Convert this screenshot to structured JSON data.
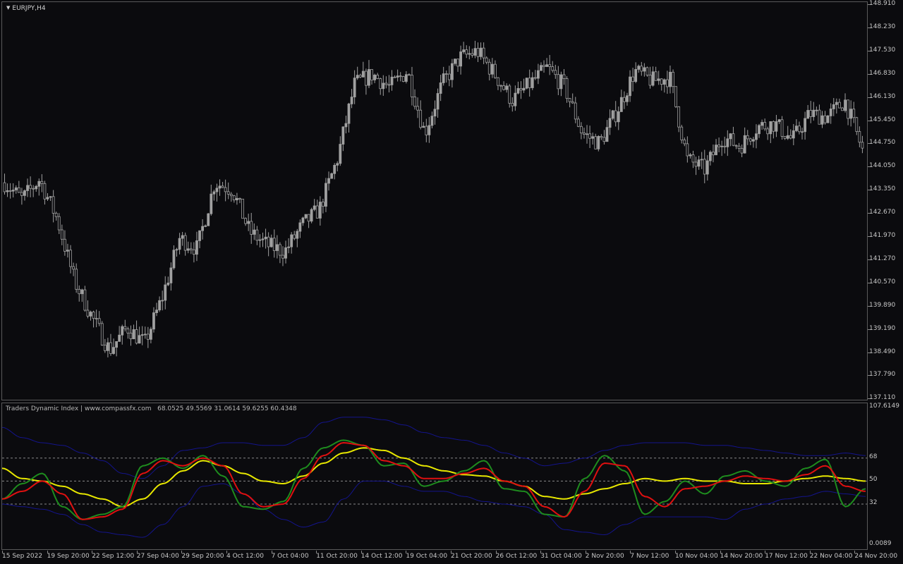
{
  "chart_title": "EURJPY,H4",
  "price_axis": [
    "148.910",
    "148.230",
    "147.530",
    "146.830",
    "146.130",
    "145.450",
    "144.750",
    "144.050",
    "143.350",
    "142.670",
    "141.970",
    "141.270",
    "140.570",
    "139.890",
    "139.190",
    "138.490",
    "137.790",
    "137.110"
  ],
  "indicator": {
    "name": "Traders Dynamic Index | www.compassfx.com",
    "values": "68.0525 49.5569 31.0614 59.6255 60.4348",
    "axis_top": "107.6149",
    "levels": [
      "68",
      "50",
      "32"
    ],
    "axis_bottom": "0.0089"
  },
  "time_axis": [
    "15 Sep 2022",
    "19 Sep 20:00",
    "22 Sep 12:00",
    "27 Sep 04:00",
    "29 Sep 20:00",
    "4 Oct 12:00",
    "7 Oct 04:00",
    "11 Oct 20:00",
    "14 Oct 12:00",
    "19 Oct 04:00",
    "21 Oct 20:00",
    "26 Oct 12:00",
    "31 Oct 04:00",
    "2 Nov 20:00",
    "7 Nov 12:00",
    "10 Nov 04:00",
    "14 Nov 20:00",
    "17 Nov 12:00",
    "22 Nov 04:00",
    "24 Nov 20:00"
  ],
  "colors": {
    "background": "#0b0b0e",
    "candle": "#a0a0a0",
    "rsi_line": "#1e8c1e",
    "signal_line": "#e01010",
    "market_base": "#e8e800",
    "bands": "#14148c",
    "level_lines": "#8a8a8a"
  },
  "chart_data": [
    {
      "type": "candlestick",
      "title": "EURJPY,H4",
      "ylim": [
        137.11,
        148.91
      ],
      "close_trace": [
        [
          "15 Sep 2022",
          143.5
        ],
        [
          "16 Sep",
          143.0
        ],
        [
          "19 Sep 20:00",
          143.6
        ],
        [
          "20 Sep",
          142.4
        ],
        [
          "21 Sep",
          140.5
        ],
        [
          "22 Sep 12:00",
          139.4
        ],
        [
          "23 Sep",
          138.4
        ],
        [
          "26 Sep",
          139.1
        ],
        [
          "27 Sep 04:00",
          138.6
        ],
        [
          "28 Sep",
          140.0
        ],
        [
          "29 Sep 20:00",
          141.8
        ],
        [
          "3 Oct",
          141.5
        ],
        [
          "4 Oct 12:00",
          143.5
        ],
        [
          "5 Oct",
          143.3
        ],
        [
          "6 Oct",
          142.0
        ],
        [
          "7 Oct 04:00",
          141.6
        ],
        [
          "10 Oct",
          141.4
        ],
        [
          "11 Oct 20:00",
          142.2
        ],
        [
          "12 Oct",
          142.7
        ],
        [
          "13 Oct",
          144.2
        ],
        [
          "14 Oct 12:00",
          146.5
        ],
        [
          "17 Oct",
          146.8
        ],
        [
          "18 Oct",
          146.4
        ],
        [
          "19 Oct 04:00",
          146.9
        ],
        [
          "20 Oct",
          145.0
        ],
        [
          "21 Oct 20:00",
          146.5
        ],
        [
          "24 Oct",
          147.3
        ],
        [
          "25 Oct",
          147.5
        ],
        [
          "26 Oct 12:00",
          146.8
        ],
        [
          "27 Oct",
          146.0
        ],
        [
          "28 Oct",
          146.5
        ],
        [
          "31 Oct 04:00",
          147.0
        ],
        [
          "1 Nov",
          146.4
        ],
        [
          "2 Nov 20:00",
          145.0
        ],
        [
          "3 Nov",
          144.7
        ],
        [
          "4 Nov",
          145.7
        ],
        [
          "7 Nov 12:00",
          146.9
        ],
        [
          "8 Nov",
          146.6
        ],
        [
          "9 Nov",
          146.7
        ],
        [
          "10 Nov 04:00",
          144.2
        ],
        [
          "11 Nov",
          143.9
        ],
        [
          "14 Nov 20:00",
          144.9
        ],
        [
          "15 Nov",
          144.6
        ],
        [
          "16 Nov",
          145.2
        ],
        [
          "17 Nov 12:00",
          145.3
        ],
        [
          "18 Nov",
          144.8
        ],
        [
          "21 Nov",
          145.6
        ],
        [
          "22 Nov 04:00",
          145.5
        ],
        [
          "23 Nov",
          146.0
        ],
        [
          "24 Nov 20:00",
          144.5
        ]
      ]
    },
    {
      "type": "line",
      "title": "Traders Dynamic Index",
      "ylim": [
        0.0089,
        107.6149
      ],
      "levels": [
        68,
        50,
        32
      ],
      "series": [
        {
          "name": "rsi",
          "color": "#1e8c1e",
          "values": [
            36,
            48,
            56,
            30,
            20,
            24,
            30,
            62,
            68,
            60,
            70,
            54,
            30,
            28,
            34,
            60,
            76,
            82,
            78,
            62,
            64,
            46,
            50,
            58,
            66,
            44,
            42,
            24,
            22,
            52,
            70,
            58,
            24,
            34,
            50,
            40,
            54,
            58,
            50,
            46,
            60,
            67,
            30,
            44
          ]
        },
        {
          "name": "signal",
          "color": "#e01010",
          "values": [
            36,
            42,
            50,
            40,
            20,
            22,
            28,
            56,
            66,
            62,
            68,
            62,
            40,
            30,
            32,
            52,
            70,
            80,
            78,
            66,
            62,
            52,
            52,
            56,
            60,
            50,
            46,
            30,
            22,
            42,
            64,
            62,
            38,
            30,
            44,
            46,
            50,
            54,
            52,
            50,
            55,
            62,
            46,
            42
          ]
        },
        {
          "name": "market-base",
          "color": "#e8e800",
          "values": [
            60,
            52,
            50,
            46,
            40,
            36,
            30,
            36,
            48,
            58,
            66,
            62,
            56,
            50,
            48,
            54,
            64,
            72,
            76,
            74,
            68,
            62,
            58,
            55,
            54,
            50,
            46,
            38,
            36,
            40,
            44,
            48,
            52,
            50,
            52,
            50,
            50,
            48,
            48,
            50,
            52,
            54,
            52,
            50
          ]
        },
        {
          "name": "upper-band",
          "color": "#14148c",
          "values": [
            92,
            84,
            80,
            78,
            72,
            66,
            56,
            52,
            62,
            74,
            76,
            80,
            80,
            78,
            78,
            84,
            96,
            100,
            100,
            98,
            94,
            88,
            84,
            82,
            78,
            72,
            68,
            62,
            64,
            68,
            74,
            78,
            80,
            80,
            80,
            78,
            78,
            76,
            74,
            72,
            70,
            70,
            72,
            70
          ]
        },
        {
          "name": "lower-band",
          "color": "#14148c",
          "values": [
            32,
            30,
            28,
            24,
            16,
            10,
            8,
            6,
            16,
            30,
            46,
            48,
            40,
            28,
            20,
            14,
            18,
            36,
            50,
            50,
            46,
            42,
            42,
            38,
            34,
            32,
            30,
            24,
            12,
            10,
            8,
            16,
            22,
            22,
            22,
            22,
            20,
            28,
            32,
            36,
            38,
            42,
            40,
            38
          ]
        }
      ]
    }
  ]
}
